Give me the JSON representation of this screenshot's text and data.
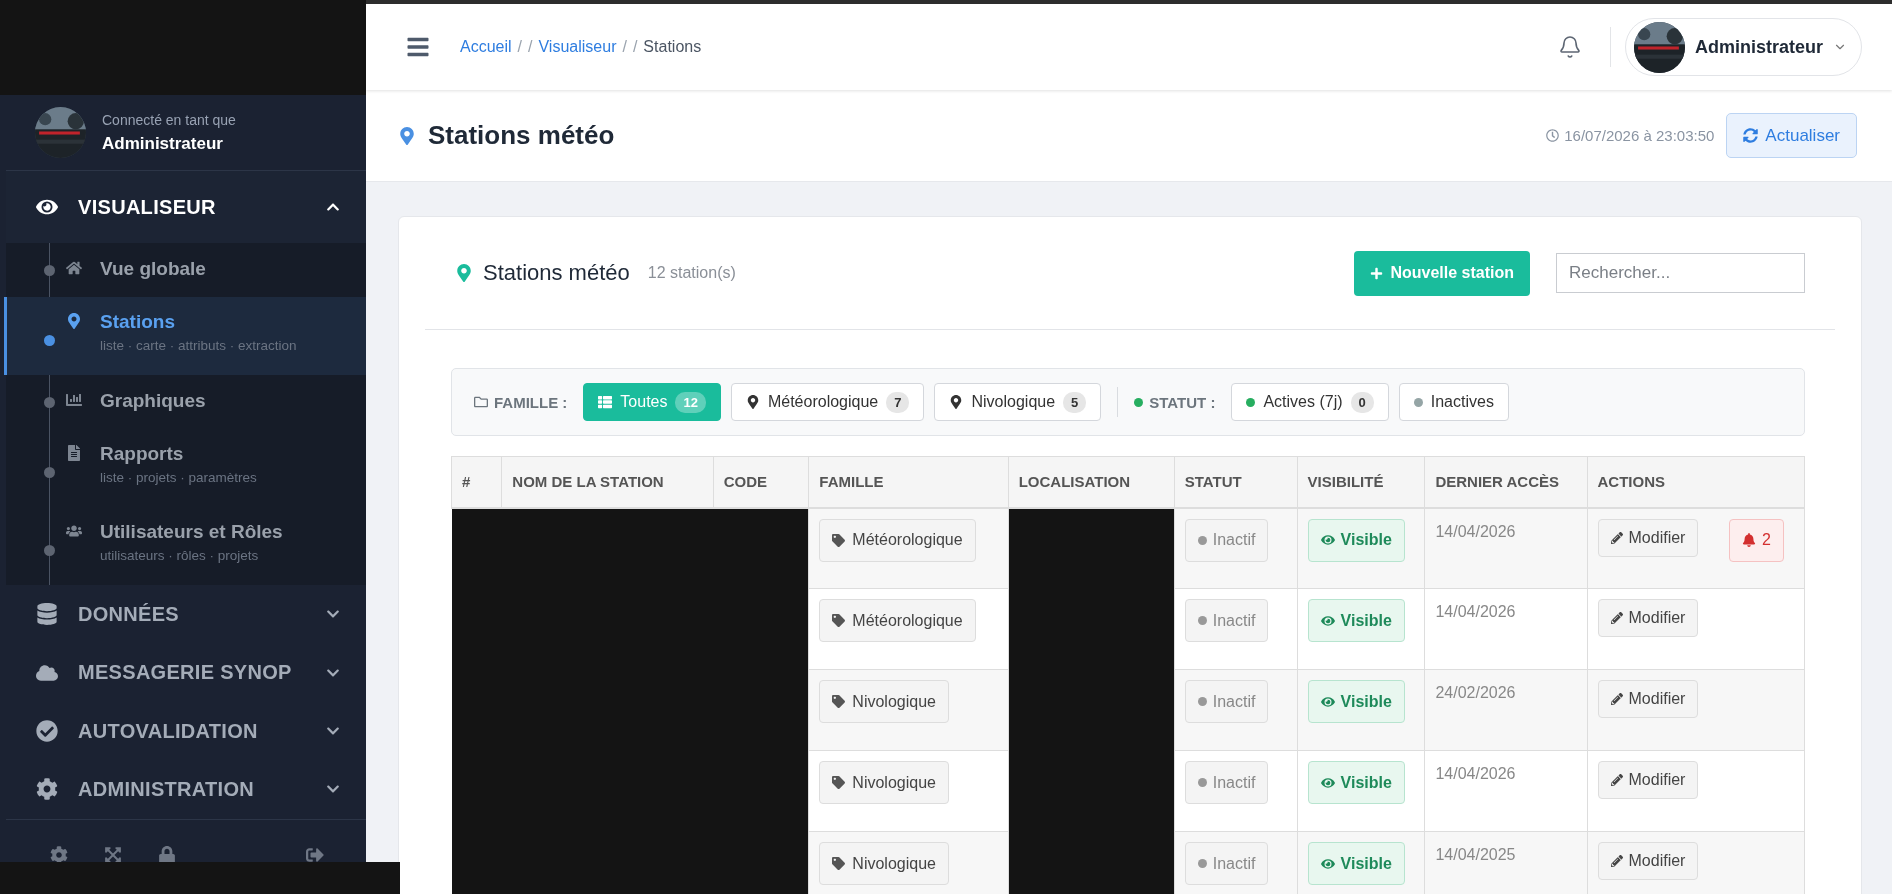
{
  "sidebar": {
    "user": {
      "caption": "Connecté en tant que",
      "name": "Administrateur"
    },
    "sections": [
      {
        "label": "VISUALISEUR",
        "expanded": true,
        "children": [
          {
            "label": "Vue globale",
            "selected": false
          },
          {
            "label": "Stations",
            "selected": true,
            "subtitle": "liste · carte · attributs · extraction"
          },
          {
            "label": "Graphiques",
            "selected": false
          },
          {
            "label": "Rapports",
            "selected": false,
            "subtitle": "liste · projets · paramètres"
          },
          {
            "label": "Utilisateurs et Rôles",
            "selected": false,
            "subtitle": "utilisateurs · rôles · projets"
          }
        ]
      },
      {
        "label": "DONNÉES",
        "expanded": false
      },
      {
        "label": "MESSAGERIE SYNOP",
        "expanded": false
      },
      {
        "label": "AUTOVALIDATION",
        "expanded": false
      },
      {
        "label": "ADMINISTRATION",
        "expanded": false
      }
    ]
  },
  "header": {
    "breadcrumb": [
      {
        "kind": "link",
        "label": "Accueil"
      },
      {
        "kind": "sep",
        "label": "/"
      },
      {
        "kind": "sep",
        "label": "/"
      },
      {
        "kind": "link",
        "label": "Visualiseur"
      },
      {
        "kind": "sep",
        "label": "/"
      },
      {
        "kind": "sep",
        "label": "/"
      },
      {
        "kind": "current",
        "label": "Stations"
      }
    ],
    "user_name": "Administrateur"
  },
  "page": {
    "title": "Stations météo",
    "timestamp": "16/07/2026 à 23:03:50",
    "refresh_button": "Actualiser"
  },
  "card": {
    "title": "Stations météo",
    "count": "12 station(s)",
    "new_button": "Nouvelle station",
    "search": {
      "placeholder": "Rechercher..."
    }
  },
  "filters": {
    "family_label": "FAMILLE :",
    "families": [
      {
        "label": "Toutes",
        "count": "12",
        "kind": "all",
        "selected": true
      },
      {
        "label": "Météorologique",
        "count": "7",
        "kind": "family",
        "selected": false
      },
      {
        "label": "Nivologique",
        "count": "5",
        "kind": "family",
        "selected": false
      }
    ],
    "status_label": "STATUT :",
    "statuses": [
      {
        "label": "Actives (7j)",
        "count": "0",
        "color": "#27ae60",
        "selected": false
      },
      {
        "label": "Inactives",
        "color": "#95a5a6",
        "selected": false
      }
    ]
  },
  "table": {
    "columns": [
      "#",
      "NOM DE LA STATION",
      "CODE",
      "FAMILLE",
      "LOCALISATION",
      "STATUT",
      "VISIBILITÉ",
      "DERNIER ACCÈS",
      "ACTIONS"
    ],
    "rows": [
      {
        "family": "Météorologique",
        "status": "Inactif",
        "active": false,
        "visibility": "Visible",
        "visible": true,
        "last_access": "14/04/2026",
        "action": "Modifier",
        "alert_count": "2"
      },
      {
        "family": "Météorologique",
        "status": "Inactif",
        "active": false,
        "visibility": "Visible",
        "visible": true,
        "last_access": "14/04/2026",
        "action": "Modifier"
      },
      {
        "family": "Nivologique",
        "status": "Inactif",
        "active": false,
        "visibility": "Visible",
        "visible": true,
        "last_access": "24/02/2026",
        "action": "Modifier"
      },
      {
        "family": "Nivologique",
        "status": "Inactif",
        "active": false,
        "visibility": "Visible",
        "visible": true,
        "last_access": "14/04/2026",
        "action": "Modifier"
      },
      {
        "family": "Nivologique",
        "status": "Inactif",
        "active": false,
        "visibility": "Visible",
        "visible": true,
        "last_access": "14/04/2025",
        "action": "Modifier"
      }
    ]
  }
}
